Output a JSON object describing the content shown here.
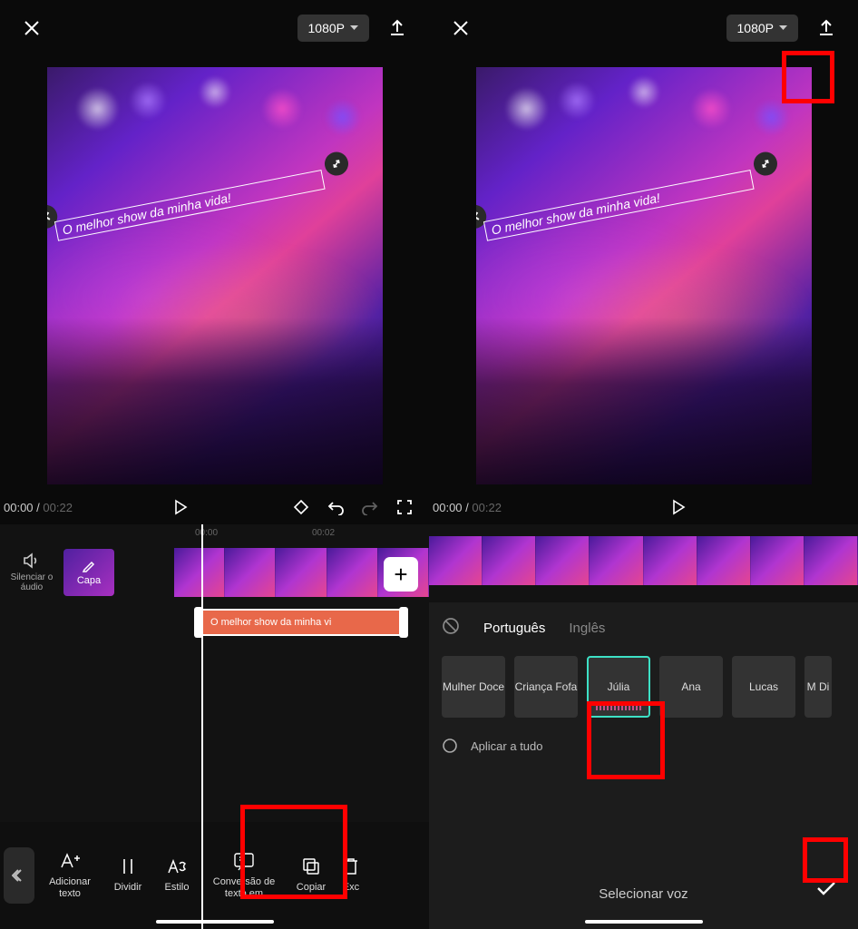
{
  "left": {
    "resolution": "1080P",
    "overlay_text": "O melhor show da minha vida!",
    "time_current": "00:00",
    "time_total": "00:22",
    "timecodes": [
      "00:00",
      "00:02"
    ],
    "mute_label": "Silenciar o áudio",
    "cover_label": "Capa",
    "text_clip": "O melhor show da minha vi",
    "tools": {
      "add_text": "Adicionar texto",
      "split": "Dividir",
      "style": "Estilo",
      "tts": "Conversão de texto em",
      "copy": "Copiar",
      "delete": "Exc"
    }
  },
  "right": {
    "resolution": "1080P",
    "overlay_text": "O melhor show da minha vida!",
    "time_current": "00:00",
    "time_total": "00:22",
    "languages": {
      "pt": "Português",
      "en": "Inglês"
    },
    "voices": [
      "Mulher Doce",
      "Criança Fofa",
      "Júlia",
      "Ana",
      "Lucas",
      "M Di"
    ],
    "selected_voice_index": 2,
    "apply_all": "Aplicar a tudo",
    "panel_title": "Selecionar voz"
  }
}
